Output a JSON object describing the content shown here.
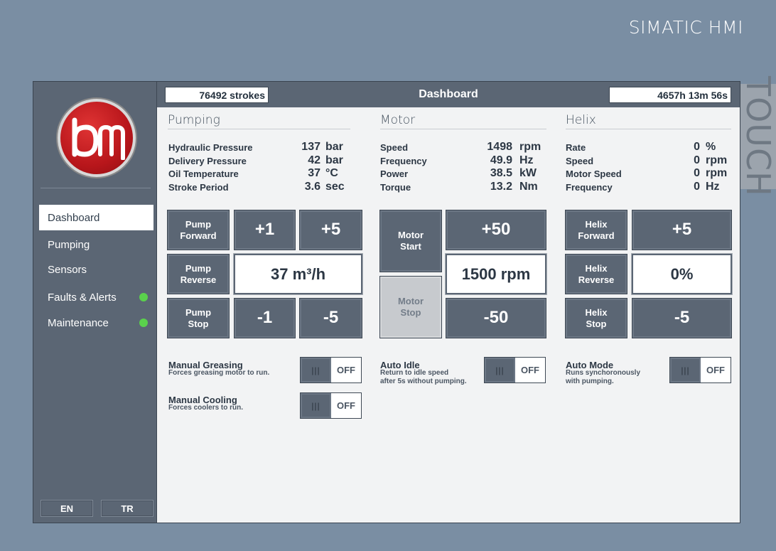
{
  "brand": "SIMATIC HMI",
  "side_label": "TOUCH",
  "header": {
    "strokes": "76492 strokes",
    "title": "Dashboard",
    "runtime": "4657h 13m 56s"
  },
  "sidebar": {
    "items": [
      {
        "label": "Dashboard",
        "active": true
      },
      {
        "label": "Pumping"
      },
      {
        "label": "Sensors"
      },
      {
        "label": "Faults & Alerts",
        "status": "green"
      },
      {
        "label": "Maintenance",
        "status": "green"
      }
    ],
    "lang": [
      "EN",
      "TR"
    ]
  },
  "pumping": {
    "title": "Pumping",
    "rows": [
      {
        "label": "Hydraulic Pressure",
        "value": "137",
        "unit": "bar"
      },
      {
        "label": "Delivery Pressure",
        "value": "42",
        "unit": "bar"
      },
      {
        "label": "Oil Temperature",
        "value": "37",
        "unit": "°C"
      },
      {
        "label": "Stroke Period",
        "value": "3.6",
        "unit": "sec"
      }
    ],
    "btn_forward": "Pump\nForward",
    "btn_reverse": "Pump\nReverse",
    "btn_stop": "Pump\nStop",
    "plus1": "+1",
    "plus5": "+5",
    "minus1": "-1",
    "minus5": "-5",
    "setpoint": "37 m³/h"
  },
  "motor": {
    "title": "Motor",
    "rows": [
      {
        "label": "Speed",
        "value": "1498",
        "unit": "rpm"
      },
      {
        "label": "Frequency",
        "value": "49.9",
        "unit": "Hz"
      },
      {
        "label": "Power",
        "value": "38.5",
        "unit": "kW"
      },
      {
        "label": "Torque",
        "value": "13.2",
        "unit": "Nm"
      }
    ],
    "btn_start": "Motor\nStart",
    "btn_stop": "Motor\nStop",
    "plus50": "+50",
    "minus50": "-50",
    "setpoint": "1500 rpm"
  },
  "helix": {
    "title": "Helix",
    "rows": [
      {
        "label": "Rate",
        "value": "0",
        "unit": "%"
      },
      {
        "label": "Speed",
        "value": "0",
        "unit": "rpm"
      },
      {
        "label": "Motor Speed",
        "value": "0",
        "unit": "rpm"
      },
      {
        "label": "Frequency",
        "value": "0",
        "unit": "Hz"
      }
    ],
    "btn_forward": "Helix\nForward",
    "btn_reverse": "Helix\nReverse",
    "btn_stop": "Helix\nStop",
    "plus5": "+5",
    "minus5": "-5",
    "setpoint": "0%"
  },
  "toggles": {
    "greasing": {
      "title": "Manual Greasing",
      "desc": "Forces greasing motor to run.",
      "state": "OFF"
    },
    "cooling": {
      "title": "Manual Cooling",
      "desc": "Forces coolers to run.",
      "state": "OFF"
    },
    "auto_idle": {
      "title": "Auto Idle",
      "desc": "Return to idle speed\nafter 5s without pumping.",
      "state": "OFF"
    },
    "auto_mode": {
      "title": "Auto Mode",
      "desc": "Runs synchoronously\nwith pumping.",
      "state": "OFF"
    }
  },
  "grip_glyph": "|||",
  "colors": {
    "panel": "#5b6674",
    "status_ok": "#5ad14c",
    "background": "#7a8ea3"
  }
}
